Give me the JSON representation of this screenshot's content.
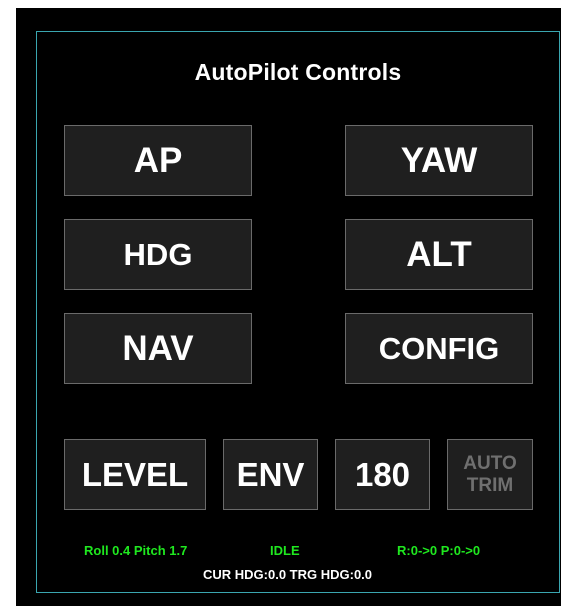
{
  "panel": {
    "title": "AutoPilot Controls"
  },
  "buttons": {
    "ap": "AP",
    "yaw": "YAW",
    "hdg": "HDG",
    "alt": "ALT",
    "nav": "NAV",
    "config": "CONFIG",
    "level": "LEVEL",
    "env": "ENV",
    "turn180": "180",
    "auto_trim_line1": "AUTO",
    "auto_trim_line2": "TRIM"
  },
  "status": {
    "roll_pitch": "Roll 0.4  Pitch 1.7",
    "mode": "IDLE",
    "trim_changes": "R:0->0  P:0->0",
    "headings": "CUR HDG:0.0  TRG HDG:0.0"
  },
  "colors": {
    "background": "#000000",
    "panel_border": "#3aa6b0",
    "button_fill": "#1f1f1f",
    "button_border": "#6a6a6a",
    "status_green": "#1fe81f",
    "disabled_text": "#6f6f6f"
  }
}
